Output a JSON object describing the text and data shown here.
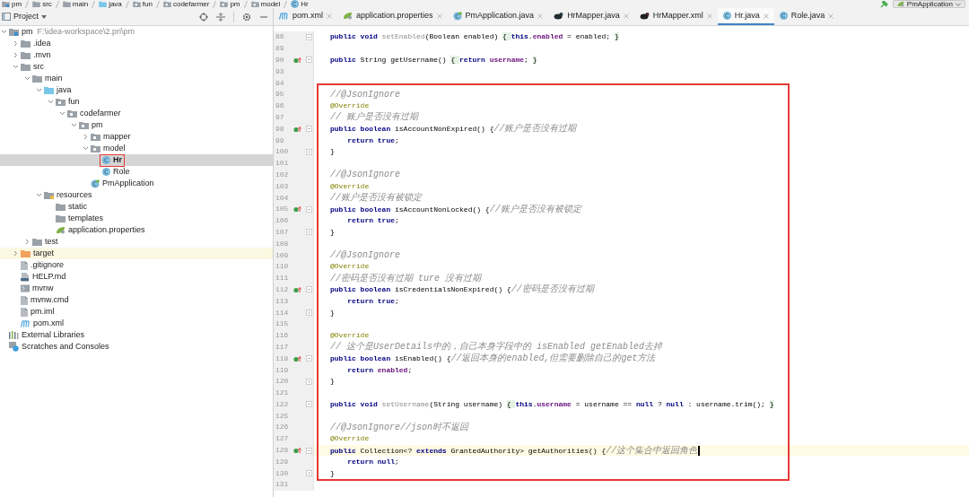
{
  "breadcrumbs": [
    {
      "label": "pm",
      "kind": "module"
    },
    {
      "label": "src",
      "kind": "folder"
    },
    {
      "label": "main",
      "kind": "folder"
    },
    {
      "label": "java",
      "kind": "source-folder"
    },
    {
      "label": "fun",
      "kind": "package"
    },
    {
      "label": "codefarmer",
      "kind": "package"
    },
    {
      "label": "pm",
      "kind": "package"
    },
    {
      "label": "model",
      "kind": "package"
    },
    {
      "label": "Hr",
      "kind": "class"
    }
  ],
  "run_config": {
    "label": "PmApplication"
  },
  "project_panel": {
    "title": "Project",
    "tree": [
      {
        "label": "pm",
        "path": "F:\\idea-workspace\\2.pri\\pm",
        "kind": "module",
        "expanded": true,
        "selected": false,
        "children": [
          {
            "label": ".idea",
            "kind": "folder",
            "expanded": false,
            "selected": false
          },
          {
            "label": ".mvn",
            "kind": "folder",
            "expanded": false,
            "selected": false
          },
          {
            "label": "src",
            "kind": "folder",
            "expanded": true,
            "selected": false,
            "children": [
              {
                "label": "main",
                "kind": "folder",
                "expanded": true,
                "selected": false,
                "children": [
                  {
                    "label": "java",
                    "kind": "source-folder",
                    "expanded": true,
                    "selected": false,
                    "children": [
                      {
                        "label": "fun",
                        "kind": "package",
                        "expanded": true,
                        "selected": false,
                        "children": [
                          {
                            "label": "codefarmer",
                            "kind": "package",
                            "expanded": true,
                            "selected": false,
                            "children": [
                              {
                                "label": "pm",
                                "kind": "package",
                                "expanded": true,
                                "selected": false,
                                "children": [
                                  {
                                    "label": "mapper",
                                    "kind": "package",
                                    "expanded": false,
                                    "selected": false
                                  },
                                  {
                                    "label": "model",
                                    "kind": "package",
                                    "expanded": true,
                                    "selected": false,
                                    "children": [
                                      {
                                        "label": "Hr",
                                        "kind": "class",
                                        "selected": true,
                                        "boxed": true
                                      },
                                      {
                                        "label": "Role",
                                        "kind": "class",
                                        "selected": false
                                      }
                                    ]
                                  },
                                  {
                                    "label": "PmApplication",
                                    "kind": "spring-class",
                                    "selected": false
                                  }
                                ]
                              }
                            ]
                          }
                        ]
                      }
                    ]
                  },
                  {
                    "label": "resources",
                    "kind": "resources",
                    "expanded": true,
                    "selected": false,
                    "children": [
                      {
                        "label": "static",
                        "kind": "folder",
                        "selected": false
                      },
                      {
                        "label": "templates",
                        "kind": "folder",
                        "selected": false
                      },
                      {
                        "label": "application.properties",
                        "kind": "properties",
                        "selected": false
                      }
                    ]
                  }
                ]
              },
              {
                "label": "test",
                "kind": "folder",
                "expanded": false,
                "selected": false
              }
            ]
          },
          {
            "label": "target",
            "kind": "excluded",
            "expanded": false,
            "selected": false
          },
          {
            "label": ".gitignore",
            "kind": "file",
            "selected": false
          },
          {
            "label": "HELP.md",
            "kind": "markdown",
            "selected": false
          },
          {
            "label": "mvnw",
            "kind": "script",
            "selected": false
          },
          {
            "label": "mvnw.cmd",
            "kind": "file",
            "selected": false
          },
          {
            "label": "pm.iml",
            "kind": "file",
            "selected": false
          },
          {
            "label": "pom.xml",
            "kind": "maven",
            "selected": false
          }
        ]
      },
      {
        "label": "External Libraries",
        "kind": "libraries",
        "selected": false
      },
      {
        "label": "Scratches and Consoles",
        "kind": "scratches",
        "selected": false
      }
    ]
  },
  "tabs": [
    {
      "label": "pom.xml",
      "kind": "maven",
      "selected": false
    },
    {
      "label": "application.properties",
      "kind": "properties",
      "selected": false
    },
    {
      "label": "PmApplication.java",
      "kind": "spring-class",
      "selected": false
    },
    {
      "label": "HrMapper.java",
      "kind": "mapper-java",
      "selected": false
    },
    {
      "label": "HrMapper.xml",
      "kind": "mapper-xml",
      "selected": false
    },
    {
      "label": "Hr.java",
      "kind": "class",
      "selected": true
    },
    {
      "label": "Role.java",
      "kind": "class",
      "selected": false
    }
  ],
  "editor": {
    "lines": [
      {
        "number": "86",
        "fold_start": true,
        "tokens": [
          {
            "kind": "keyword",
            "text": "public void "
          },
          {
            "kind": "unused",
            "text": "setEnabled"
          },
          {
            "kind": "plain",
            "text": "(Boolean enabled) "
          },
          {
            "kind": "folded",
            "text": "{ "
          },
          {
            "kind": "keyword",
            "text": "this"
          },
          {
            "kind": "plain",
            "text": "."
          },
          {
            "kind": "field",
            "text": "enabled"
          },
          {
            "kind": "plain",
            "text": " = enabled; "
          },
          {
            "kind": "folded",
            "text": "}"
          }
        ]
      },
      {
        "number": "89"
      },
      {
        "number": "90",
        "override": true,
        "fold_start": true,
        "tokens": [
          {
            "kind": "keyword",
            "text": "public "
          },
          {
            "kind": "plain",
            "text": "String getUsername() "
          },
          {
            "kind": "folded",
            "text": "{ "
          },
          {
            "kind": "keyword",
            "text": "return "
          },
          {
            "kind": "field",
            "text": "username"
          },
          {
            "kind": "plain",
            "text": "; "
          },
          {
            "kind": "folded",
            "text": "}"
          }
        ]
      },
      {
        "number": "93"
      },
      {
        "number": "94"
      }
    ],
    "highlighted_block": {
      "lines": [
        {
          "number": "95",
          "tokens": [
            {
              "kind": "comment",
              "text": "//@JsonIgnore"
            }
          ]
        },
        {
          "number": "96",
          "tokens": [
            {
              "kind": "annotation",
              "text": "@Override"
            }
          ]
        },
        {
          "number": "97",
          "tokens": [
            {
              "kind": "comment",
              "text": "// 账户是否没有过期"
            }
          ]
        },
        {
          "number": "98",
          "override": true,
          "fold_start": true,
          "tokens": [
            {
              "kind": "keyword",
              "text": "public boolean "
            },
            {
              "kind": "plain",
              "text": "isAccountNonExpired() {"
            },
            {
              "kind": "comment",
              "text": "//账户是否没有过期"
            }
          ]
        },
        {
          "number": "99",
          "tokens": [
            {
              "kind": "keyword",
              "text": "    return true"
            },
            {
              "kind": "plain",
              "text": ";"
            }
          ]
        },
        {
          "number": "100",
          "fold_end": true,
          "tokens": [
            {
              "kind": "plain",
              "text": "}"
            }
          ]
        },
        {
          "number": "101"
        },
        {
          "number": "102",
          "tokens": [
            {
              "kind": "comment",
              "text": "//@JsonIgnore"
            }
          ]
        },
        {
          "number": "103",
          "tokens": [
            {
              "kind": "annotation",
              "text": "@Override"
            }
          ]
        },
        {
          "number": "104",
          "tokens": [
            {
              "kind": "comment",
              "text": "//账户是否没有被锁定"
            }
          ]
        },
        {
          "number": "105",
          "override": true,
          "fold_start": true,
          "tokens": [
            {
              "kind": "keyword",
              "text": "public boolean "
            },
            {
              "kind": "plain",
              "text": "isAccountNonLocked() {"
            },
            {
              "kind": "comment",
              "text": "//账户是否没有被锁定"
            }
          ]
        },
        {
          "number": "106",
          "tokens": [
            {
              "kind": "keyword",
              "text": "    return true"
            },
            {
              "kind": "plain",
              "text": ";"
            }
          ]
        },
        {
          "number": "107",
          "fold_end": true,
          "tokens": [
            {
              "kind": "plain",
              "text": "}"
            }
          ]
        },
        {
          "number": "108"
        },
        {
          "number": "109",
          "tokens": [
            {
              "kind": "comment",
              "text": "//@JsonIgnore"
            }
          ]
        },
        {
          "number": "110",
          "tokens": [
            {
              "kind": "annotation",
              "text": "@Override"
            }
          ]
        },
        {
          "number": "111",
          "tokens": [
            {
              "kind": "comment",
              "text": "//密码是否没有过期 ture 没有过期"
            }
          ]
        },
        {
          "number": "112",
          "override": true,
          "fold_start": true,
          "tokens": [
            {
              "kind": "keyword",
              "text": "public boolean "
            },
            {
              "kind": "plain",
              "text": "isCredentialsNonExpired() {"
            },
            {
              "kind": "comment",
              "text": "//密码是否没有过期"
            }
          ]
        },
        {
          "number": "113",
          "tokens": [
            {
              "kind": "keyword",
              "text": "    return true"
            },
            {
              "kind": "plain",
              "text": ";"
            }
          ]
        },
        {
          "number": "114",
          "fold_end": true,
          "tokens": [
            {
              "kind": "plain",
              "text": "}"
            }
          ]
        },
        {
          "number": "115"
        },
        {
          "number": "116",
          "tokens": [
            {
              "kind": "annotation",
              "text": "@Override"
            }
          ]
        },
        {
          "number": "117",
          "tokens": [
            {
              "kind": "comment",
              "text": "// 这个是UserDetails中的，自己本身字段中的 isEnabled getEnabled去掉"
            }
          ]
        },
        {
          "number": "118",
          "override": true,
          "fold_start": true,
          "tokens": [
            {
              "kind": "keyword",
              "text": "public boolean "
            },
            {
              "kind": "plain",
              "text": "isEnabled() {"
            },
            {
              "kind": "comment",
              "text": "//返回本身的enabled,但需要删除自己的get方法"
            }
          ]
        },
        {
          "number": "119",
          "tokens": [
            {
              "kind": "keyword",
              "text": "    return "
            },
            {
              "kind": "field",
              "text": "enabled"
            },
            {
              "kind": "plain",
              "text": ";"
            }
          ]
        },
        {
          "number": "120",
          "fold_end": true,
          "tokens": [
            {
              "kind": "plain",
              "text": "}"
            }
          ]
        },
        {
          "number": "121"
        },
        {
          "number": "122",
          "fold_start": true,
          "tokens": [
            {
              "kind": "keyword",
              "text": "public void "
            },
            {
              "kind": "unused",
              "text": "setUsername"
            },
            {
              "kind": "plain",
              "text": "(String username) "
            },
            {
              "kind": "folded",
              "text": "{ "
            },
            {
              "kind": "keyword",
              "text": "this"
            },
            {
              "kind": "plain",
              "text": "."
            },
            {
              "kind": "field",
              "text": "username"
            },
            {
              "kind": "plain",
              "text": " = username == "
            },
            {
              "kind": "keyword",
              "text": "null"
            },
            {
              "kind": "plain",
              "text": " ? "
            },
            {
              "kind": "keyword",
              "text": "null"
            },
            {
              "kind": "plain",
              "text": " : username.trim(); "
            },
            {
              "kind": "folded",
              "text": "}"
            }
          ]
        },
        {
          "number": "125"
        },
        {
          "number": "126",
          "tokens": [
            {
              "kind": "comment",
              "text": "//@JsonIgnore//json时不返回"
            }
          ]
        },
        {
          "number": "127",
          "tokens": [
            {
              "kind": "annotation",
              "text": "@Override"
            }
          ]
        },
        {
          "number": "128",
          "override": true,
          "fold_start": true,
          "current": true,
          "tokens": [
            {
              "kind": "keyword",
              "text": "public "
            },
            {
              "kind": "plain",
              "text": "Collection<? "
            },
            {
              "kind": "keyword",
              "text": "extends "
            },
            {
              "kind": "plain",
              "text": "GrantedAuthority> getAuthorities() {"
            },
            {
              "kind": "comment",
              "text": "//这个集合中返回角色"
            }
          ]
        },
        {
          "number": "129",
          "tokens": [
            {
              "kind": "keyword",
              "text": "    return null"
            },
            {
              "kind": "plain",
              "text": ";"
            }
          ]
        },
        {
          "number": "130",
          "fold_end": true,
          "tokens": [
            {
              "kind": "plain",
              "text": "}"
            }
          ]
        }
      ]
    },
    "lines_after": [
      {
        "number": "131"
      }
    ]
  }
}
